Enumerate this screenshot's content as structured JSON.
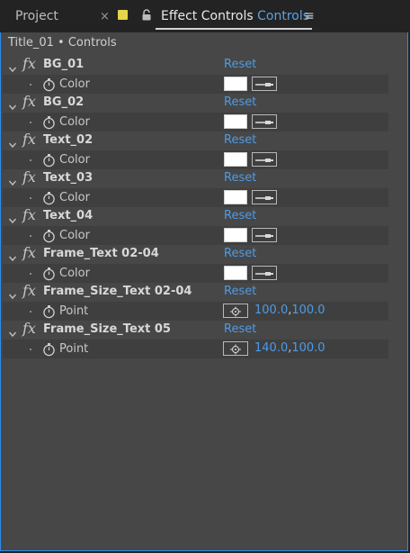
{
  "tabs": {
    "project_label": "Project",
    "close_glyph": "×",
    "effect_controls_label": "Effect Controls",
    "effect_controls_target": "Controls",
    "menu_glyph": "≡"
  },
  "panel": {
    "title": "Title_01 • Controls"
  },
  "effects": [
    {
      "name": "BG_01",
      "reset": "Reset",
      "prop": "Color",
      "type": "color",
      "value": "#ffffff"
    },
    {
      "name": "BG_02",
      "reset": "Reset",
      "prop": "Color",
      "type": "color",
      "value": "#ffffff"
    },
    {
      "name": "Text_02",
      "reset": "Reset",
      "prop": "Color",
      "type": "color",
      "value": "#ffffff"
    },
    {
      "name": "Text_03",
      "reset": "Reset",
      "prop": "Color",
      "type": "color",
      "value": "#ffffff"
    },
    {
      "name": "Text_04",
      "reset": "Reset",
      "prop": "Color",
      "type": "color",
      "value": "#ffffff"
    },
    {
      "name": "Frame_Text 02-04",
      "reset": "Reset",
      "prop": "Color",
      "type": "color",
      "value": "#ffffff"
    },
    {
      "name": "Frame_Size_Text 02-04",
      "reset": "Reset",
      "prop": "Point",
      "type": "point",
      "x": "100.0",
      "y": "100.0"
    },
    {
      "name": "Frame_Size_Text 05",
      "reset": "Reset",
      "prop": "Point",
      "type": "point",
      "x": "140.0",
      "y": "100.0"
    }
  ],
  "colors": {
    "accent": "#4d9be6",
    "panel_border": "#2d8ceb",
    "tab_swatch": "#e3d64a"
  }
}
